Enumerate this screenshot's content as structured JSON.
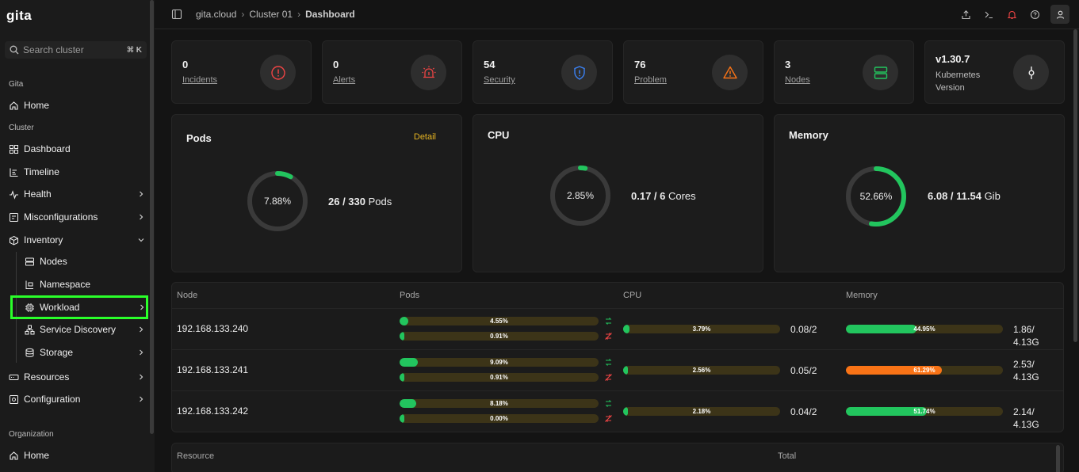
{
  "app": {
    "logo": "gita"
  },
  "search": {
    "placeholder": "Search cluster",
    "shortcut": "⌘ K"
  },
  "sidebar": {
    "section_gita": "Gita",
    "home": "Home",
    "section_cluster": "Cluster",
    "dashboard": "Dashboard",
    "timeline": "Timeline",
    "health": "Health",
    "misconfigurations": "Misconfigurations",
    "inventory": "Inventory",
    "nodes": "Nodes",
    "namespace": "Namespace",
    "workload": "Workload",
    "service_discovery": "Service Discovery",
    "storage": "Storage",
    "resources": "Resources",
    "configuration": "Configuration",
    "section_org": "Organization",
    "org_home": "Home"
  },
  "breadcrumb": [
    "gita.cloud",
    "Cluster 01",
    "Dashboard"
  ],
  "stats": [
    {
      "value": "0",
      "label": "Incidents"
    },
    {
      "value": "0",
      "label": "Alerts"
    },
    {
      "value": "54",
      "label": "Security"
    },
    {
      "value": "76",
      "label": "Problem"
    },
    {
      "value": "3",
      "label": "Nodes"
    },
    {
      "value": "v1.30.7",
      "label": "Kubernetes Version"
    }
  ],
  "panels": {
    "pods": {
      "title": "Pods",
      "detail": "Detail",
      "percent": "7.88%",
      "fraction": 0.0788,
      "used": "26 / 330",
      "unit": " Pods"
    },
    "cpu": {
      "title": "CPU",
      "percent": "2.85%",
      "fraction": 0.0285,
      "used": "0.17 / 6",
      "unit": " Cores"
    },
    "memory": {
      "title": "Memory",
      "percent": "52.66%",
      "fraction": 0.5266,
      "used": "6.08 / 11.54",
      "unit": " Gib"
    }
  },
  "node_table": {
    "headers": [
      "Node",
      "Pods",
      "CPU",
      "Memory"
    ],
    "rows": [
      {
        "ip": "192.168.133.240",
        "pods_a": "4.55%",
        "pods_a_frac": 0.0455,
        "pods_b": "0.91%",
        "pods_b_frac": 0.0091,
        "cpu": "3.79%",
        "cpu_frac": 0.0379,
        "cpu_val": "0.08/2",
        "mem": "44.95%",
        "mem_frac": 0.4495,
        "mem_val": "1.86/ 4.13G",
        "mem_color": "#22c55e"
      },
      {
        "ip": "192.168.133.241",
        "pods_a": "9.09%",
        "pods_a_frac": 0.0909,
        "pods_b": "0.91%",
        "pods_b_frac": 0.0091,
        "cpu": "2.56%",
        "cpu_frac": 0.0256,
        "cpu_val": "0.05/2",
        "mem": "61.29%",
        "mem_frac": 0.6129,
        "mem_val": "2.53/ 4.13G",
        "mem_color": "#f97316"
      },
      {
        "ip": "192.168.133.242",
        "pods_a": "8.18%",
        "pods_a_frac": 0.0818,
        "pods_b": "0.00%",
        "pods_b_frac": 0.0,
        "cpu": "2.18%",
        "cpu_frac": 0.0218,
        "cpu_val": "0.04/2",
        "mem": "51.74%",
        "mem_frac": 0.5174,
        "mem_val": "2.14/ 4.13G",
        "mem_color": "#22c55e"
      }
    ]
  },
  "resource_table": {
    "headers": [
      "Resource",
      "Total"
    ]
  },
  "colors": {
    "accent_green": "#22c55e",
    "detail_yellow": "#e6b422",
    "alert_red": "#ef4444",
    "warn_orange": "#f97316",
    "security_blue": "#3b82f6",
    "active_outline": "#2aff2a"
  }
}
